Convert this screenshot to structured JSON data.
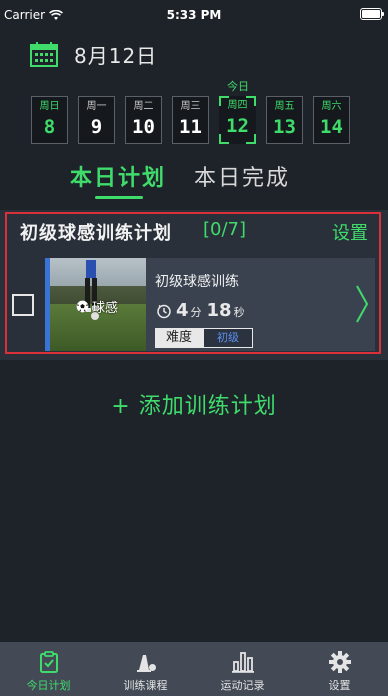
{
  "status_bar": {
    "carrier": "Carrier",
    "time": "5:33 PM"
  },
  "header": {
    "date": "8月12日",
    "today_marker": "今日"
  },
  "week": [
    {
      "name": "周日",
      "num": "8",
      "state": "weekend"
    },
    {
      "name": "周一",
      "num": "9",
      "state": "normal"
    },
    {
      "name": "周二",
      "num": "10",
      "state": "normal"
    },
    {
      "name": "周三",
      "num": "11",
      "state": "normal"
    },
    {
      "name": "周四",
      "num": "12",
      "state": "today"
    },
    {
      "name": "周五",
      "num": "13",
      "state": "weekend"
    },
    {
      "name": "周六",
      "num": "14",
      "state": "weekend"
    }
  ],
  "tabs": {
    "plan": "本日计划",
    "done": "本日完成",
    "active": "plan"
  },
  "plan": {
    "title": "初级球感训练计划",
    "count": "[0/7]",
    "settings": "设置",
    "item": {
      "thumb_label": "球感",
      "title": "初级球感训练",
      "minutes": "4",
      "minutes_unit": "分",
      "seconds": "18",
      "seconds_unit": "秒",
      "difficulty_label": "难度",
      "difficulty_value": "初级"
    }
  },
  "add_plan": "+ 添加训练计划",
  "tabbar": {
    "items": [
      {
        "label": "今日计划",
        "icon": "clipboard-check-icon",
        "active": true
      },
      {
        "label": "训练课程",
        "icon": "cone-ball-icon",
        "active": false
      },
      {
        "label": "运动记录",
        "icon": "bar-chart-icon",
        "active": false
      },
      {
        "label": "设置",
        "icon": "gear-icon",
        "active": false
      }
    ]
  },
  "colors": {
    "accent": "#3fdc6c",
    "background": "#1e2229",
    "panel": "#2a3039",
    "highlight_border": "#d9303a",
    "card_accent": "#3a73d6"
  }
}
